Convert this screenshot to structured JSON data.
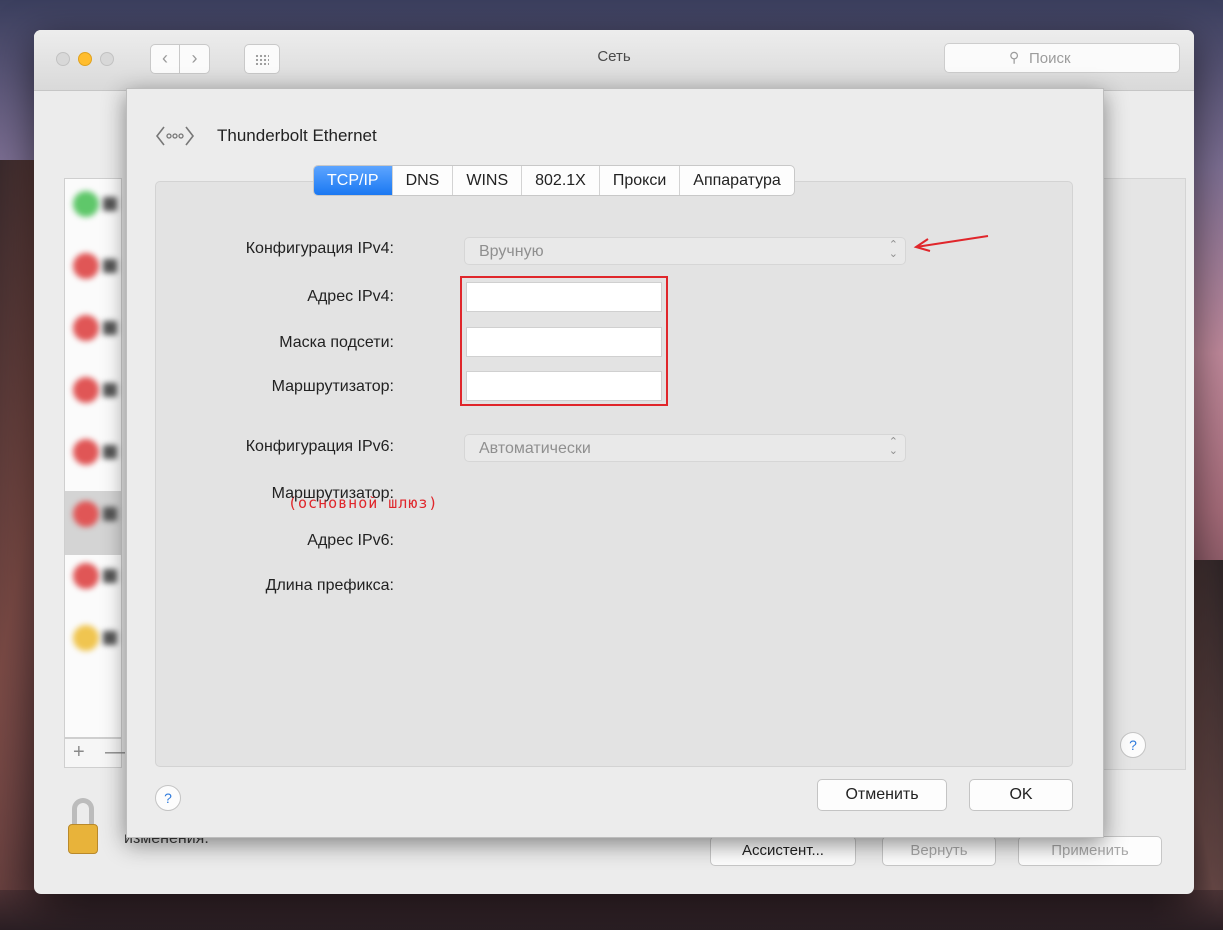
{
  "window": {
    "title": "Сеть",
    "search_placeholder": "Поиск"
  },
  "background_pane": {
    "lock_text": "изменения.",
    "buttons": {
      "assistant": "Ассистент...",
      "revert": "Вернуть",
      "apply": "Применить"
    },
    "add_symbol": "+",
    "remove_symbol": "—",
    "help_symbol": "?",
    "service_status_colors": [
      "#5fc76a",
      "#e05656",
      "#e05656",
      "#e05656",
      "#e05656",
      "#e05656",
      "#e05656",
      "#f0c550"
    ]
  },
  "sheet": {
    "interface_name": "Thunderbolt Ethernet",
    "interface_icon": "ethernet-icon",
    "tabs": [
      {
        "label": "TCP/IP",
        "active": true
      },
      {
        "label": "DNS",
        "active": false
      },
      {
        "label": "WINS",
        "active": false
      },
      {
        "label": "802.1X",
        "active": false
      },
      {
        "label": "Прокси",
        "active": false
      },
      {
        "label": "Аппаратура",
        "active": false
      }
    ],
    "ipv4_config_label": "Конфигурация IPv4:",
    "ipv4_config_value": "Вручную",
    "ipv4_address_label": "Адрес IPv4:",
    "ipv4_address_value": "",
    "subnet_mask_label": "Маска подсети:",
    "subnet_mask_value": "",
    "router_label": "Маршрутизатор:",
    "router_value": "",
    "gateway_note": "(основной шлюз)",
    "ipv6_config_label": "Конфигурация IPv6:",
    "ipv6_config_value": "Автоматически",
    "ipv6_router_label": "Маршрутизатор:",
    "ipv6_address_label": "Адрес IPv6:",
    "prefix_length_label": "Длина префикса:",
    "help_symbol": "?",
    "cancel_label": "Отменить",
    "ok_label": "OK"
  },
  "colors": {
    "accent": "#1a78f2",
    "annotation": "#e0262b"
  }
}
